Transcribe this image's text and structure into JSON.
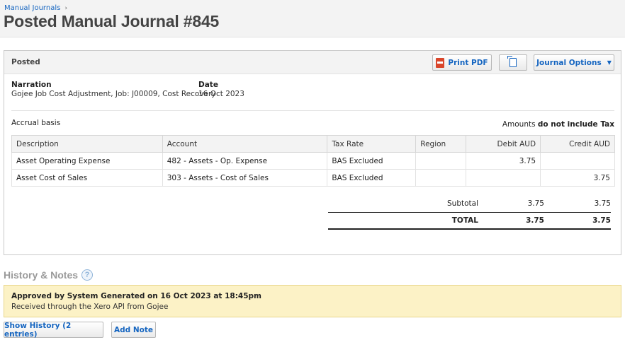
{
  "breadcrumb": {
    "parent": "Manual Journals",
    "separator": "›"
  },
  "title": "Posted Manual Journal #845",
  "status": "Posted",
  "toolbar": {
    "print_pdf": "Print PDF",
    "journal_options": "Journal Options",
    "caret": "▼"
  },
  "narration": {
    "label": "Narration",
    "value": "Gojee Job Cost Adjustment, Job: J00009, Cost Recovery"
  },
  "date": {
    "label": "Date",
    "value": "16 Oct 2023"
  },
  "basis": "Accrual basis",
  "amounts_note": {
    "prefix": "Amounts",
    "bold": "do not include Tax"
  },
  "table": {
    "headers": [
      "Description",
      "Account",
      "Tax Rate",
      "Region",
      "Debit AUD",
      "Credit AUD"
    ],
    "rows": [
      {
        "description": "Asset Operating Expense",
        "account": "482 - Assets - Op. Expense",
        "tax_rate": "BAS Excluded",
        "region": "",
        "debit": "3.75",
        "credit": ""
      },
      {
        "description": "Asset Cost of Sales",
        "account": "303 - Assets - Cost of Sales",
        "tax_rate": "BAS Excluded",
        "region": "",
        "debit": "",
        "credit": "3.75"
      }
    ]
  },
  "totals": {
    "subtotal": {
      "label": "Subtotal",
      "debit": "3.75",
      "credit": "3.75"
    },
    "total": {
      "label": "TOTAL",
      "debit": "3.75",
      "credit": "3.75"
    }
  },
  "history": {
    "title": "History & Notes",
    "help": "?",
    "notice_head": "Approved by System Generated on 16 Oct 2023 at 18:45pm",
    "notice_sub": "Received through the Xero API from Gojee",
    "show_history": "Show History (2 entries)",
    "add_note": "Add Note"
  },
  "colors": {
    "link": "#1565c0",
    "notice_bg": "#fcf2c6",
    "pdf_red": "#d9452a"
  }
}
